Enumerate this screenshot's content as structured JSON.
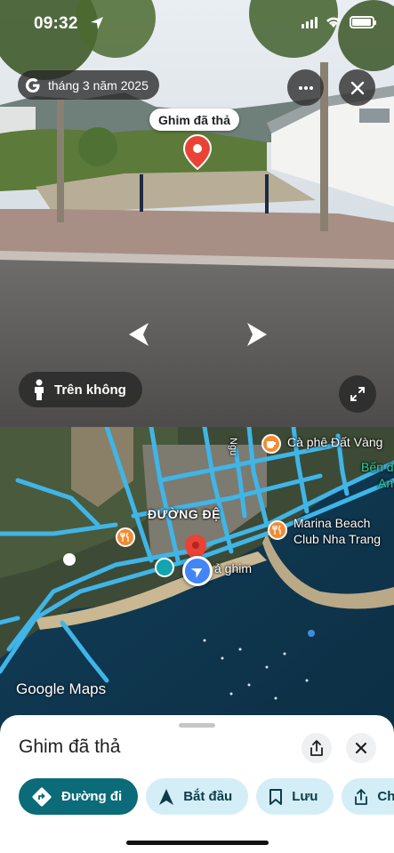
{
  "status": {
    "time": "09:32",
    "battery_level": 0.95
  },
  "streetview": {
    "date": "tháng 3 năm 2025",
    "pin_label": "Ghim đã thả",
    "mode_label": "Trên không"
  },
  "map": {
    "pois": [
      {
        "label": "Cà phê Đất Vàng"
      },
      {
        "label": "Marina Beach"
      },
      {
        "label": "Club Nha Trang"
      }
    ],
    "district": "ĐƯỜNG ĐỆ",
    "pin_text": "ả ghim",
    "edge_labels": [
      "Bến đ",
      "An",
      "Ngu"
    ],
    "logo": "Google Maps"
  },
  "sheet": {
    "title": "Ghim đã thả",
    "actions": [
      {
        "label": "Đường đi",
        "icon": "directions-icon"
      },
      {
        "label": "Bắt đầu",
        "icon": "navigation-arrow-icon"
      },
      {
        "label": "Lưu",
        "icon": "bookmark-icon"
      },
      {
        "label": "Ch",
        "icon": "share-icon"
      }
    ]
  },
  "colors": {
    "primary": "#0b6b78",
    "chip": "#d3eef6",
    "pin": "#ea4335",
    "puck": "#4285f4",
    "poi": "#f28b32",
    "road": "#3fb5e8"
  }
}
